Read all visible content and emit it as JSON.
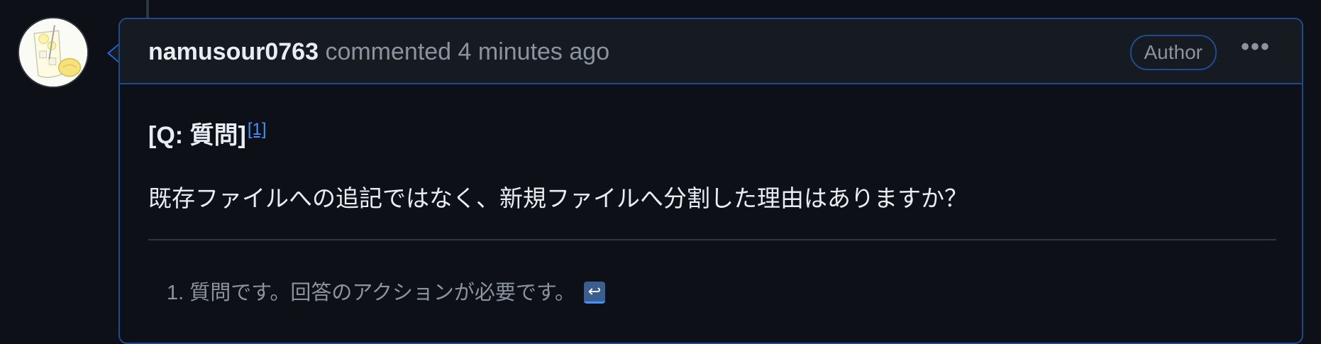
{
  "comment": {
    "author": "namusour0763",
    "action_text": " commented 4 minutes ago",
    "badge": "Author",
    "more_icon_label": "•••",
    "avatar_icon": "lemon-sour-glass-avatar",
    "heading": "[Q: 質問]",
    "footnote_ref": "[1]",
    "question": "既存ファイルへの追記ではなく、新規ファイルへ分割した理由はありますか？",
    "footnote_text": "1. 質問です。回答のアクションが必要です。",
    "backref_icon_label": "↩",
    "colors": {
      "accent_border": "#1f4b8e",
      "link": "#4493f8",
      "muted_text": "#8b949e",
      "background": "#0d1117",
      "header_background": "#161b22"
    }
  }
}
